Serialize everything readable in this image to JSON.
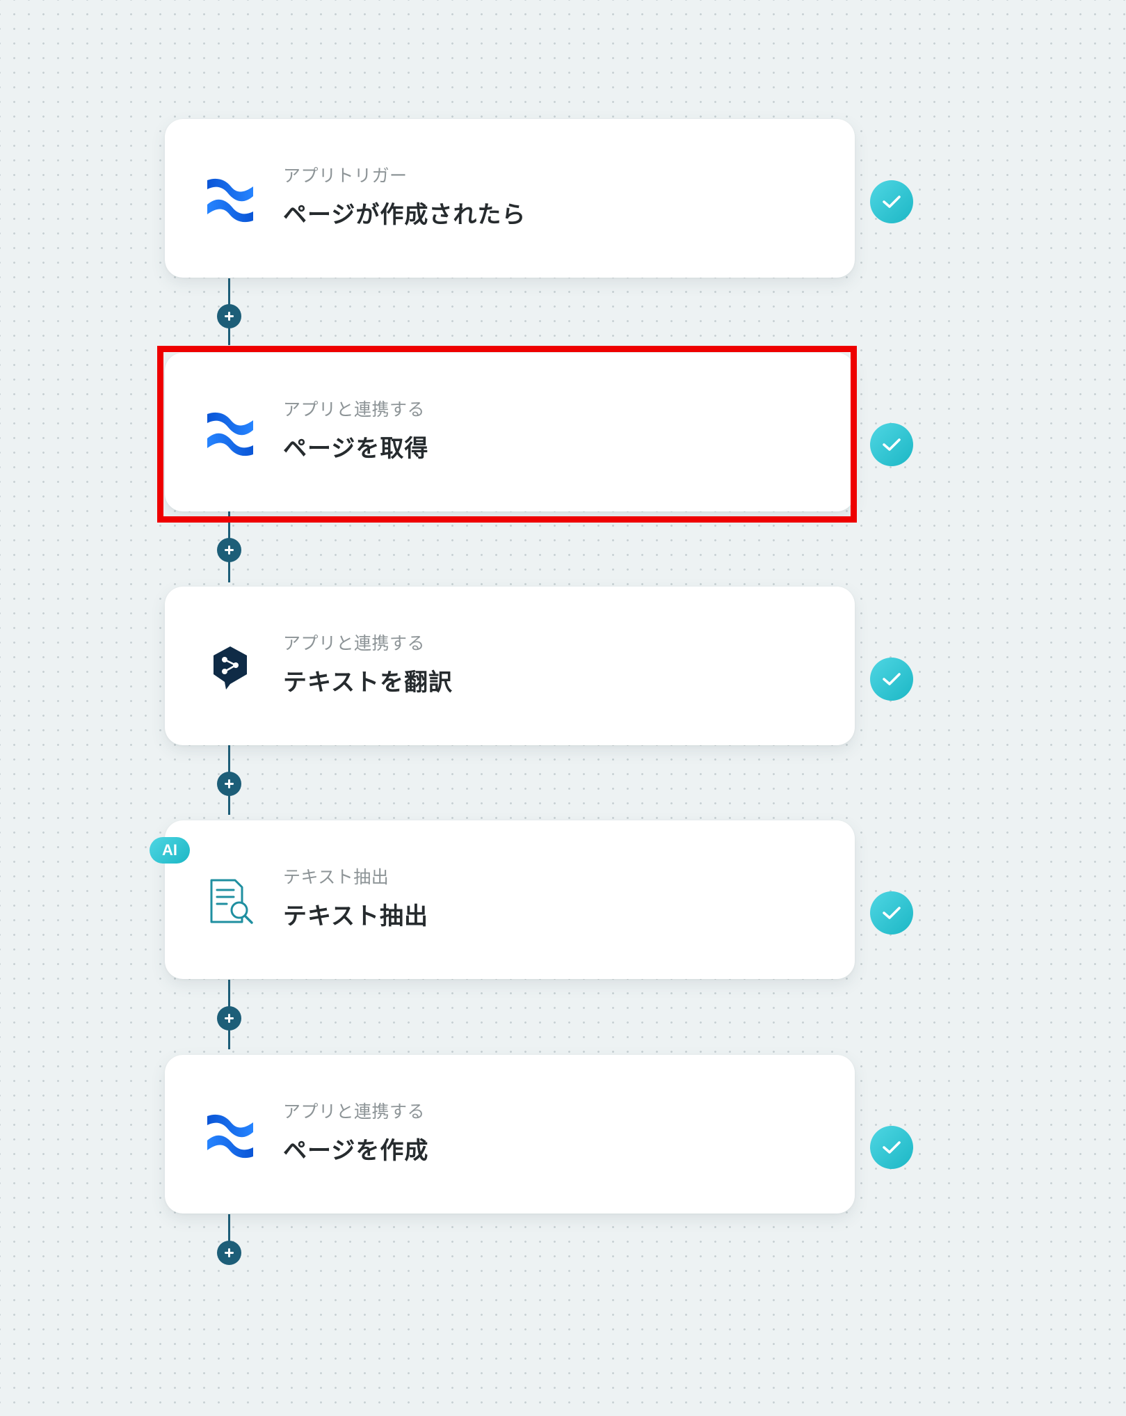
{
  "flow": {
    "steps": [
      {
        "subtitle": "アプリトリガー",
        "title": "ページが作成されたら",
        "icon": "confluence-icon",
        "status": "completed"
      },
      {
        "subtitle": "アプリと連携する",
        "title": "ページを取得",
        "icon": "confluence-icon",
        "status": "completed",
        "highlighted": true
      },
      {
        "subtitle": "アプリと連携する",
        "title": "テキストを翻訳",
        "icon": "deepl-icon",
        "status": "completed"
      },
      {
        "subtitle": "テキスト抽出",
        "title": "テキスト抽出",
        "icon": "document-search-icon",
        "badge": "AI",
        "status": "completed"
      },
      {
        "subtitle": "アプリと連携する",
        "title": "ページを作成",
        "icon": "confluence-icon",
        "status": "completed"
      }
    ]
  },
  "colors": {
    "connector": "#1d5e78",
    "check": "#29c2cf",
    "highlight": "#ee0000",
    "confluence": "#1868db",
    "deepl": "#0f2b46"
  }
}
